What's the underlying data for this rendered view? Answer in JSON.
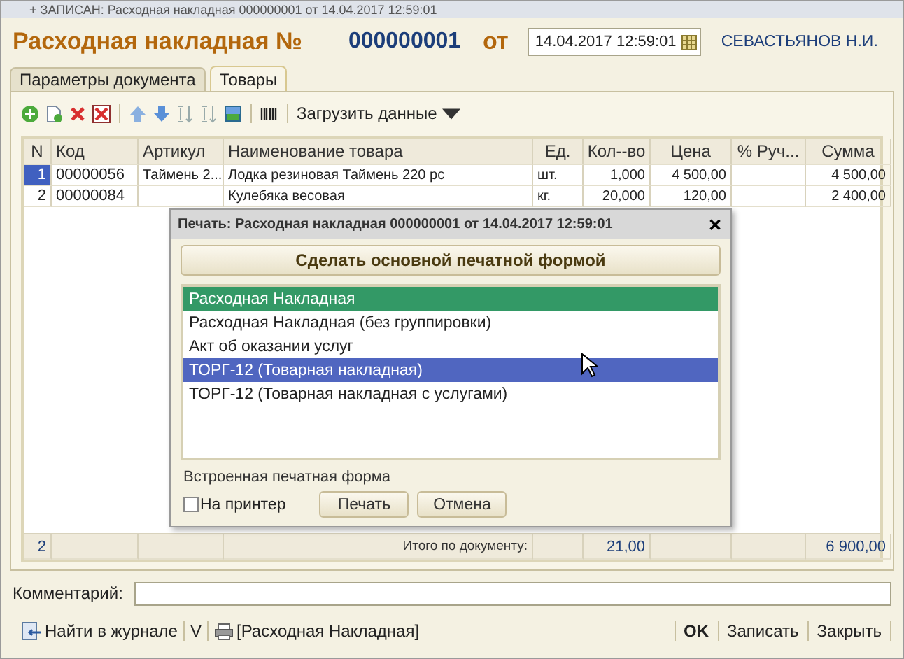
{
  "window": {
    "title": "+ ЗАПИСАН: Расходная накладная 000000001 от 14.04.2017 12:59:01"
  },
  "header": {
    "title": "Расходная накладная №",
    "number": "000000001",
    "from_label": "от",
    "date": "14.04.2017 12:59:01",
    "author": "СЕВАСТЬЯНОВ Н.И."
  },
  "tabs": [
    {
      "label": "Параметры документа",
      "selected": false
    },
    {
      "label": "Товары",
      "selected": true
    }
  ],
  "toolbar": {
    "load_button": "Загрузить данные"
  },
  "table": {
    "columns": [
      "N",
      "Код",
      "Артикул",
      "Наименование товара",
      "Ед.",
      "Кол--во",
      "Цена",
      "% Руч...",
      "Сумма"
    ],
    "rows": [
      {
        "selected": true,
        "cells": [
          "1",
          "00000056",
          "Таймень 2...",
          "Лодка резиновая Таймень 220 рс",
          "шт.",
          "1,000",
          "4 500,00",
          "",
          "4 500,00"
        ]
      },
      {
        "selected": false,
        "cells": [
          "2",
          "00000084",
          "",
          "Кулебяка весовая",
          "кг.",
          "20,000",
          "120,00",
          "",
          "2 400,00"
        ]
      }
    ],
    "totals": {
      "count": "2",
      "label": "Итого по документу:",
      "quantity": "21,00",
      "sum": "6 900,00"
    }
  },
  "comment": {
    "label": "Комментарий:"
  },
  "footer": {
    "find_link": "Найти в журнале",
    "v_link": "V",
    "print_link": "[Расходная Накладная]",
    "buttons": [
      {
        "label": "OK",
        "primary": true
      },
      {
        "label": "Записать",
        "primary": false
      },
      {
        "label": "Закрыть",
        "primary": false
      }
    ]
  },
  "dialog": {
    "title": "Печать: Расходная накладная 000000001 от 14.04.2017 12:59:01",
    "close_button": "✕",
    "make_default_button": "Сделать основной печатной формой",
    "items": [
      {
        "label": "Расходная Накладная",
        "is_default": true,
        "selected": false
      },
      {
        "label": "Расходная Накладная (без группировки)",
        "is_default": false,
        "selected": false
      },
      {
        "label": "Акт об оказании услуг",
        "is_default": false,
        "selected": false
      },
      {
        "label": "ТОРГ-12 (Товарная накладная)",
        "is_default": false,
        "selected": true
      },
      {
        "label": "ТОРГ-12 (Товарная накладная с услугами)",
        "is_default": false,
        "selected": false
      }
    ],
    "builtin_label": "Встроенная печатная форма",
    "printer": {
      "label": "На принтер",
      "checked": false
    },
    "buttons": [
      "Печать",
      "Отмена"
    ]
  }
}
